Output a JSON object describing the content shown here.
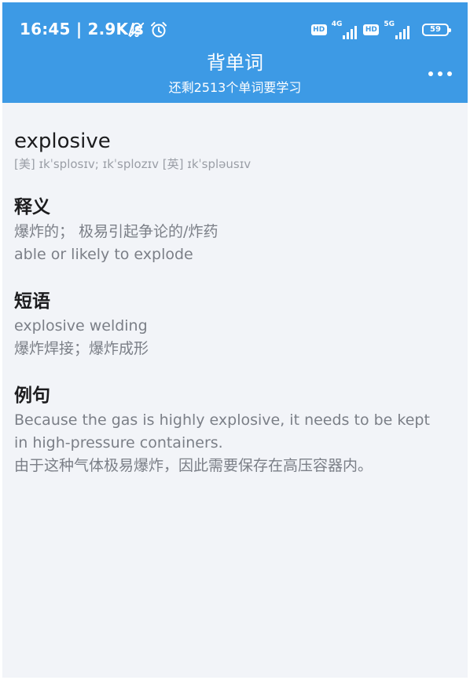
{
  "status_bar": {
    "time_speed": "16:45 | 2.9K/s",
    "icons": [
      "mute-bell-icon",
      "alarm-icon",
      "hd-icon",
      "signal-4g-icon",
      "hd-icon",
      "signal-5g-icon",
      "battery-icon"
    ],
    "hd_1": "HD",
    "net_1": "4G",
    "hd_2": "HD",
    "net_2": "5G",
    "battery": "59"
  },
  "app_bar": {
    "title": "背单词",
    "subtitle": "还剩2513个单词要学习",
    "more_icon": "more-dots-icon",
    "color": "#3d9ae5"
  },
  "word": {
    "text": "explosive",
    "phonetic": "[美] ɪkˈsplosɪv; ɪkˈsplozɪv  [英] ɪkˈspləusɪv"
  },
  "meaning": {
    "title": "释义",
    "zh": "爆炸的；  极易引起争论的/炸药",
    "en": "able or likely to explode"
  },
  "phrases": {
    "title": "短语",
    "en": "explosive welding",
    "zh": "爆炸焊接；爆炸成形"
  },
  "examples": {
    "title": "例句",
    "en_line1": "Because the gas is highly explosive, it needs to be kept",
    "en_line2": "in high-pressure containers.",
    "zh": "由于这种气体极易爆炸，因此需要保存在高压容器内。"
  }
}
